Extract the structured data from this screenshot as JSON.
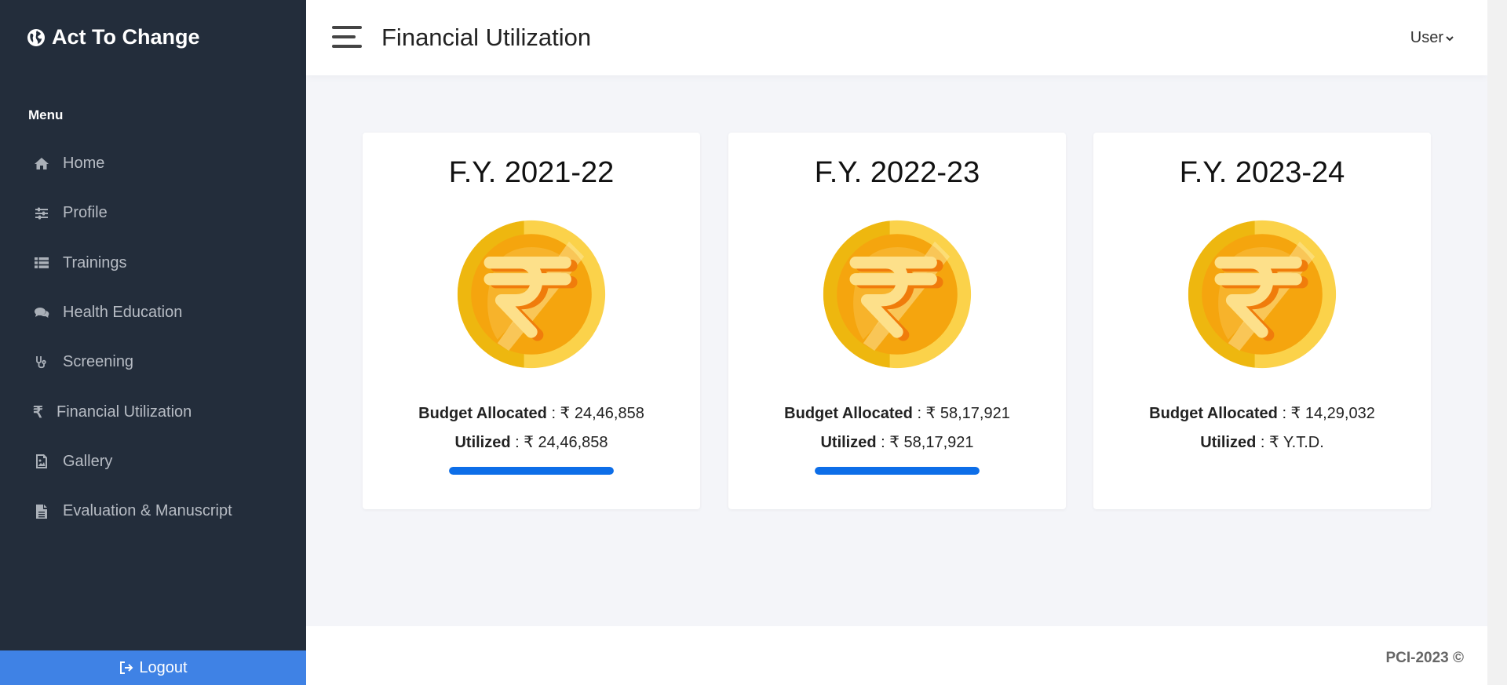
{
  "sidebar": {
    "brand": "Act To Change",
    "menu_heading": "Menu",
    "items": [
      {
        "label": "Home",
        "icon": "home-icon"
      },
      {
        "label": "Profile",
        "icon": "sliders-icon"
      },
      {
        "label": "Trainings",
        "icon": "list-icon"
      },
      {
        "label": "Health Education",
        "icon": "comments-icon"
      },
      {
        "label": "Screening",
        "icon": "stethoscope-icon"
      },
      {
        "label": "Financial Utilization",
        "icon": "rupee-icon"
      },
      {
        "label": "Gallery",
        "icon": "image-icon"
      },
      {
        "label": "Evaluation & Manuscript",
        "icon": "file-icon"
      }
    ],
    "logout_label": "Logout"
  },
  "header": {
    "title": "Financial Utilization",
    "user_label": "User"
  },
  "cards": [
    {
      "fy": "F.Y. 2021-22",
      "budget_label": "Budget Allocated",
      "budget_value": " : ₹ 24,46,858",
      "utilized_label": "Utilized",
      "utilized_value": " : ₹ 24,46,858",
      "progress": 1.0
    },
    {
      "fy": "F.Y. 2022-23",
      "budget_label": "Budget Allocated",
      "budget_value": " : ₹ 58,17,921",
      "utilized_label": "Utilized",
      "utilized_value": " : ₹ 58,17,921",
      "progress": 1.0
    },
    {
      "fy": "F.Y. 2023-24",
      "budget_label": "Budget Allocated",
      "budget_value": " : ₹ 14,29,032",
      "utilized_label": "Utilized",
      "utilized_value": " : ₹ Y.T.D.",
      "progress": null
    }
  ],
  "footer": {
    "text": "PCI-2023 ©"
  },
  "colors": {
    "sidebar_bg": "#232d3b",
    "accent": "#3f82e5",
    "progress": "#0d6ee8",
    "coin_gold": "#f7c31a"
  }
}
